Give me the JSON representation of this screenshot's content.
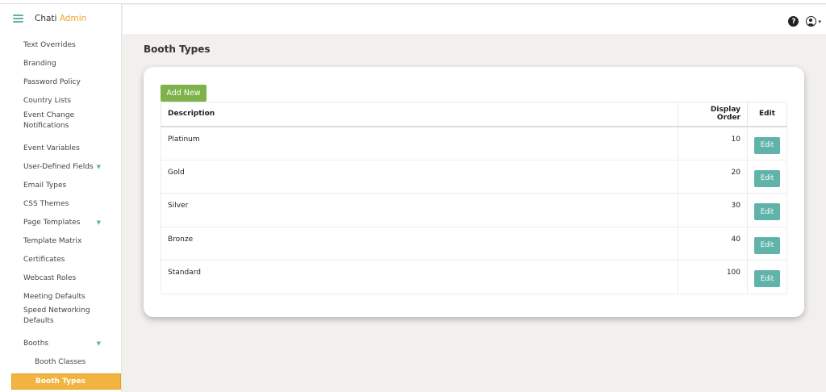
{
  "brand": {
    "name": "Chati",
    "accent": "Admin"
  },
  "topbar": {
    "help_icon": "question-circle-icon",
    "user_icon": "user-circle-icon",
    "help_glyph": "?",
    "caret_glyph": "▾"
  },
  "sidebar": {
    "items": [
      {
        "label": "Text Overrides",
        "expandable": false
      },
      {
        "label": "Branding",
        "expandable": false
      },
      {
        "label": "Password Policy",
        "expandable": false
      },
      {
        "label": "Country Lists",
        "expandable": false
      },
      {
        "label": "Event Change Notifications",
        "expandable": false
      },
      {
        "label": "Event Variables",
        "expandable": false
      },
      {
        "label": "User-Defined Fields",
        "expandable": true
      },
      {
        "label": "Email Types",
        "expandable": false
      },
      {
        "label": "CSS Themes",
        "expandable": false
      },
      {
        "label": "Page Templates",
        "expandable": true
      },
      {
        "label": "Template Matrix",
        "expandable": false
      },
      {
        "label": "Certificates",
        "expandable": false
      },
      {
        "label": "Webcast Roles",
        "expandable": false
      },
      {
        "label": "Meeting Defaults",
        "expandable": false
      },
      {
        "label": "Speed Networking Defaults",
        "expandable": false
      },
      {
        "label": "Booths",
        "expandable": true
      },
      {
        "label": "Booth Classes",
        "sub": true
      },
      {
        "label": "Booth Types",
        "sub": true,
        "active": true
      }
    ],
    "chevron_glyph": "▼"
  },
  "page": {
    "title": "Booth Types",
    "add_button": "Add New",
    "columns": {
      "description": "Description",
      "display_order": "Display Order",
      "edit": "Edit"
    },
    "rows": [
      {
        "description": "Platinum",
        "display_order": "10",
        "action": "Edit"
      },
      {
        "description": "Gold",
        "display_order": "20",
        "action": "Edit"
      },
      {
        "description": "Silver",
        "display_order": "30",
        "action": "Edit"
      },
      {
        "description": "Bronze",
        "display_order": "40",
        "action": "Edit"
      },
      {
        "description": "Standard",
        "display_order": "100",
        "action": "Edit"
      }
    ]
  },
  "colors": {
    "accent": "#f0a427",
    "teal": "#5fb3a8",
    "green": "#7fb24a",
    "background": "#f1f0ed"
  }
}
